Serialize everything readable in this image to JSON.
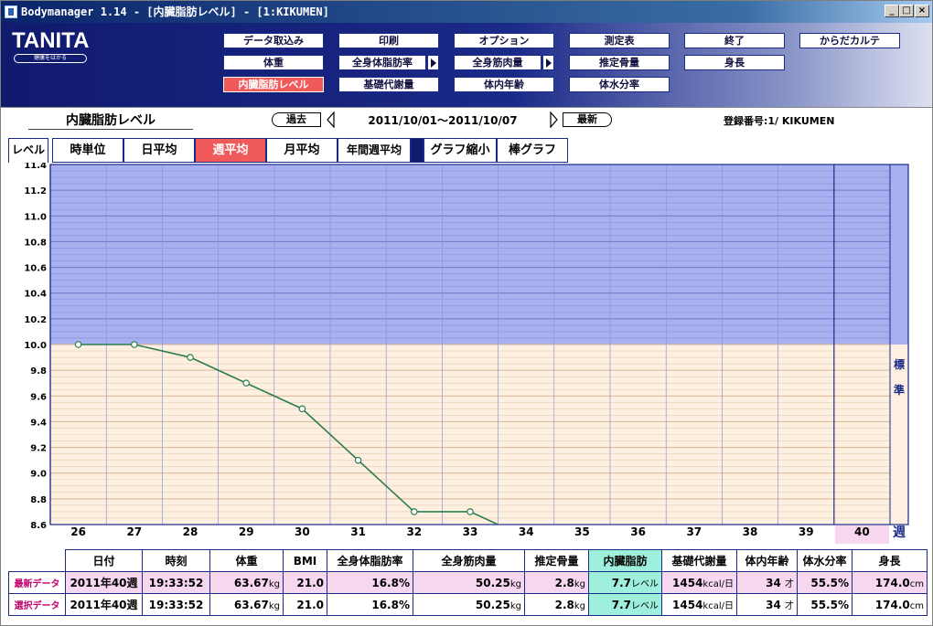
{
  "window": {
    "title": "Bodymanager 1.14 - [内臓脂肪レベル] - [1:KIKUMEN]",
    "controls": [
      "_",
      "□",
      "×"
    ]
  },
  "header": {
    "logo": "TANITA",
    "logo_tagline": "健康をはかる",
    "buttons_row1": [
      "データ取込み",
      "印刷",
      "オプション",
      "測定表",
      "終了",
      "からだカルテ"
    ],
    "buttons_row2": [
      "体重",
      "全身体脂肪率",
      "全身筋肉量",
      "推定骨量",
      "身長"
    ],
    "buttons_row3": [
      "内臓脂肪レベル",
      "基礎代謝量",
      "体内年齢",
      "体水分率"
    ]
  },
  "nav": {
    "section_title": "内臓脂肪レベル",
    "prev_label": "過去",
    "date_range": "2011/10/01～2011/10/07",
    "latest_label": "最新",
    "registration": "登録番号:1/   KIKUMEN"
  },
  "tabs": {
    "level_label": "レベル",
    "items": [
      "時単位",
      "日平均",
      "週平均",
      "月平均",
      "年間週平均",
      "グラフ縮小",
      "棒グラフ"
    ],
    "active": "週平均"
  },
  "chart_data": {
    "type": "line",
    "x": [
      26,
      27,
      28,
      29,
      30,
      31,
      32,
      33,
      34,
      35,
      36,
      37,
      38,
      39,
      40
    ],
    "series": [
      {
        "values": [
          10.0,
          10.0,
          9.9,
          9.7,
          9.5,
          9.1,
          8.7,
          8.7,
          8.5,
          null,
          null,
          null,
          null,
          null,
          null
        ]
      }
    ],
    "ylim": [
      8.6,
      11.4
    ],
    "y_ticks": [
      11.4,
      11.2,
      11.0,
      10.8,
      10.6,
      10.4,
      10.2,
      10.0,
      9.8,
      9.6,
      9.4,
      9.2,
      9.0,
      8.8,
      8.6
    ],
    "standard_threshold": 10.0,
    "zone_label": "標準",
    "x_unit": "週",
    "selected_x": 40,
    "grid": true,
    "colors": {
      "high_zone": "#a8b0f0",
      "standard_zone": "#fdf0e0",
      "line": "#2e7d4f",
      "selected": "#f7d6f0"
    }
  },
  "table": {
    "headers": [
      "日付",
      "時刻",
      "体重",
      "BMI",
      "全身体脂肪率",
      "全身筋肉量",
      "推定骨量",
      "内臓脂肪",
      "基礎代謝量",
      "体内年齢",
      "体水分率",
      "身長"
    ],
    "rows": [
      {
        "label": "最新データ",
        "cells": [
          "2011年40週",
          "19:33:52",
          "63.67",
          "21.0",
          "16.8%",
          "50.25",
          "2.8",
          "7.7",
          "1454",
          "34",
          "55.5%",
          "174.0"
        ]
      },
      {
        "label": "選択データ",
        "cells": [
          "2011年40週",
          "19:33:52",
          "63.67",
          "21.0",
          "16.8%",
          "50.25",
          "2.8",
          "7.7",
          "1454",
          "34",
          "55.5%",
          "174.0"
        ]
      }
    ],
    "units": {
      "weight": "kg",
      "muscle": "kg",
      "bone": "kg",
      "visceral": "レベル",
      "bmr": "kcal/日",
      "age": "才",
      "height": "cm"
    }
  }
}
